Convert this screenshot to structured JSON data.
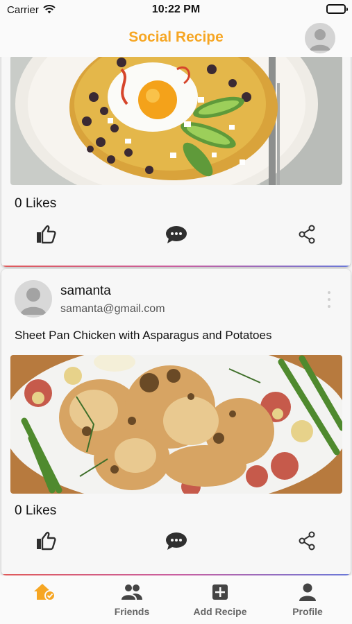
{
  "status_bar": {
    "carrier": "Carrier",
    "time": "10:22 PM"
  },
  "app_bar": {
    "title": "Social Recipe"
  },
  "posts": [
    {
      "likes": "0 Likes"
    },
    {
      "username": "samanta",
      "email": "samanta@gmail.com",
      "recipe_title": "Sheet Pan Chicken with Asparagus and Potatoes",
      "likes": "0 Likes"
    }
  ],
  "bottom_nav": {
    "items": [
      {
        "label": "",
        "icon": "home-check-icon",
        "active": true
      },
      {
        "label": "Friends",
        "icon": "friends-icon"
      },
      {
        "label": "Add Recipe",
        "icon": "add-box-icon"
      },
      {
        "label": "Profile",
        "icon": "person-icon"
      }
    ]
  },
  "colors": {
    "accent": "#f6a623",
    "icon": "#2f2f2f",
    "nav_label": "#666666"
  }
}
